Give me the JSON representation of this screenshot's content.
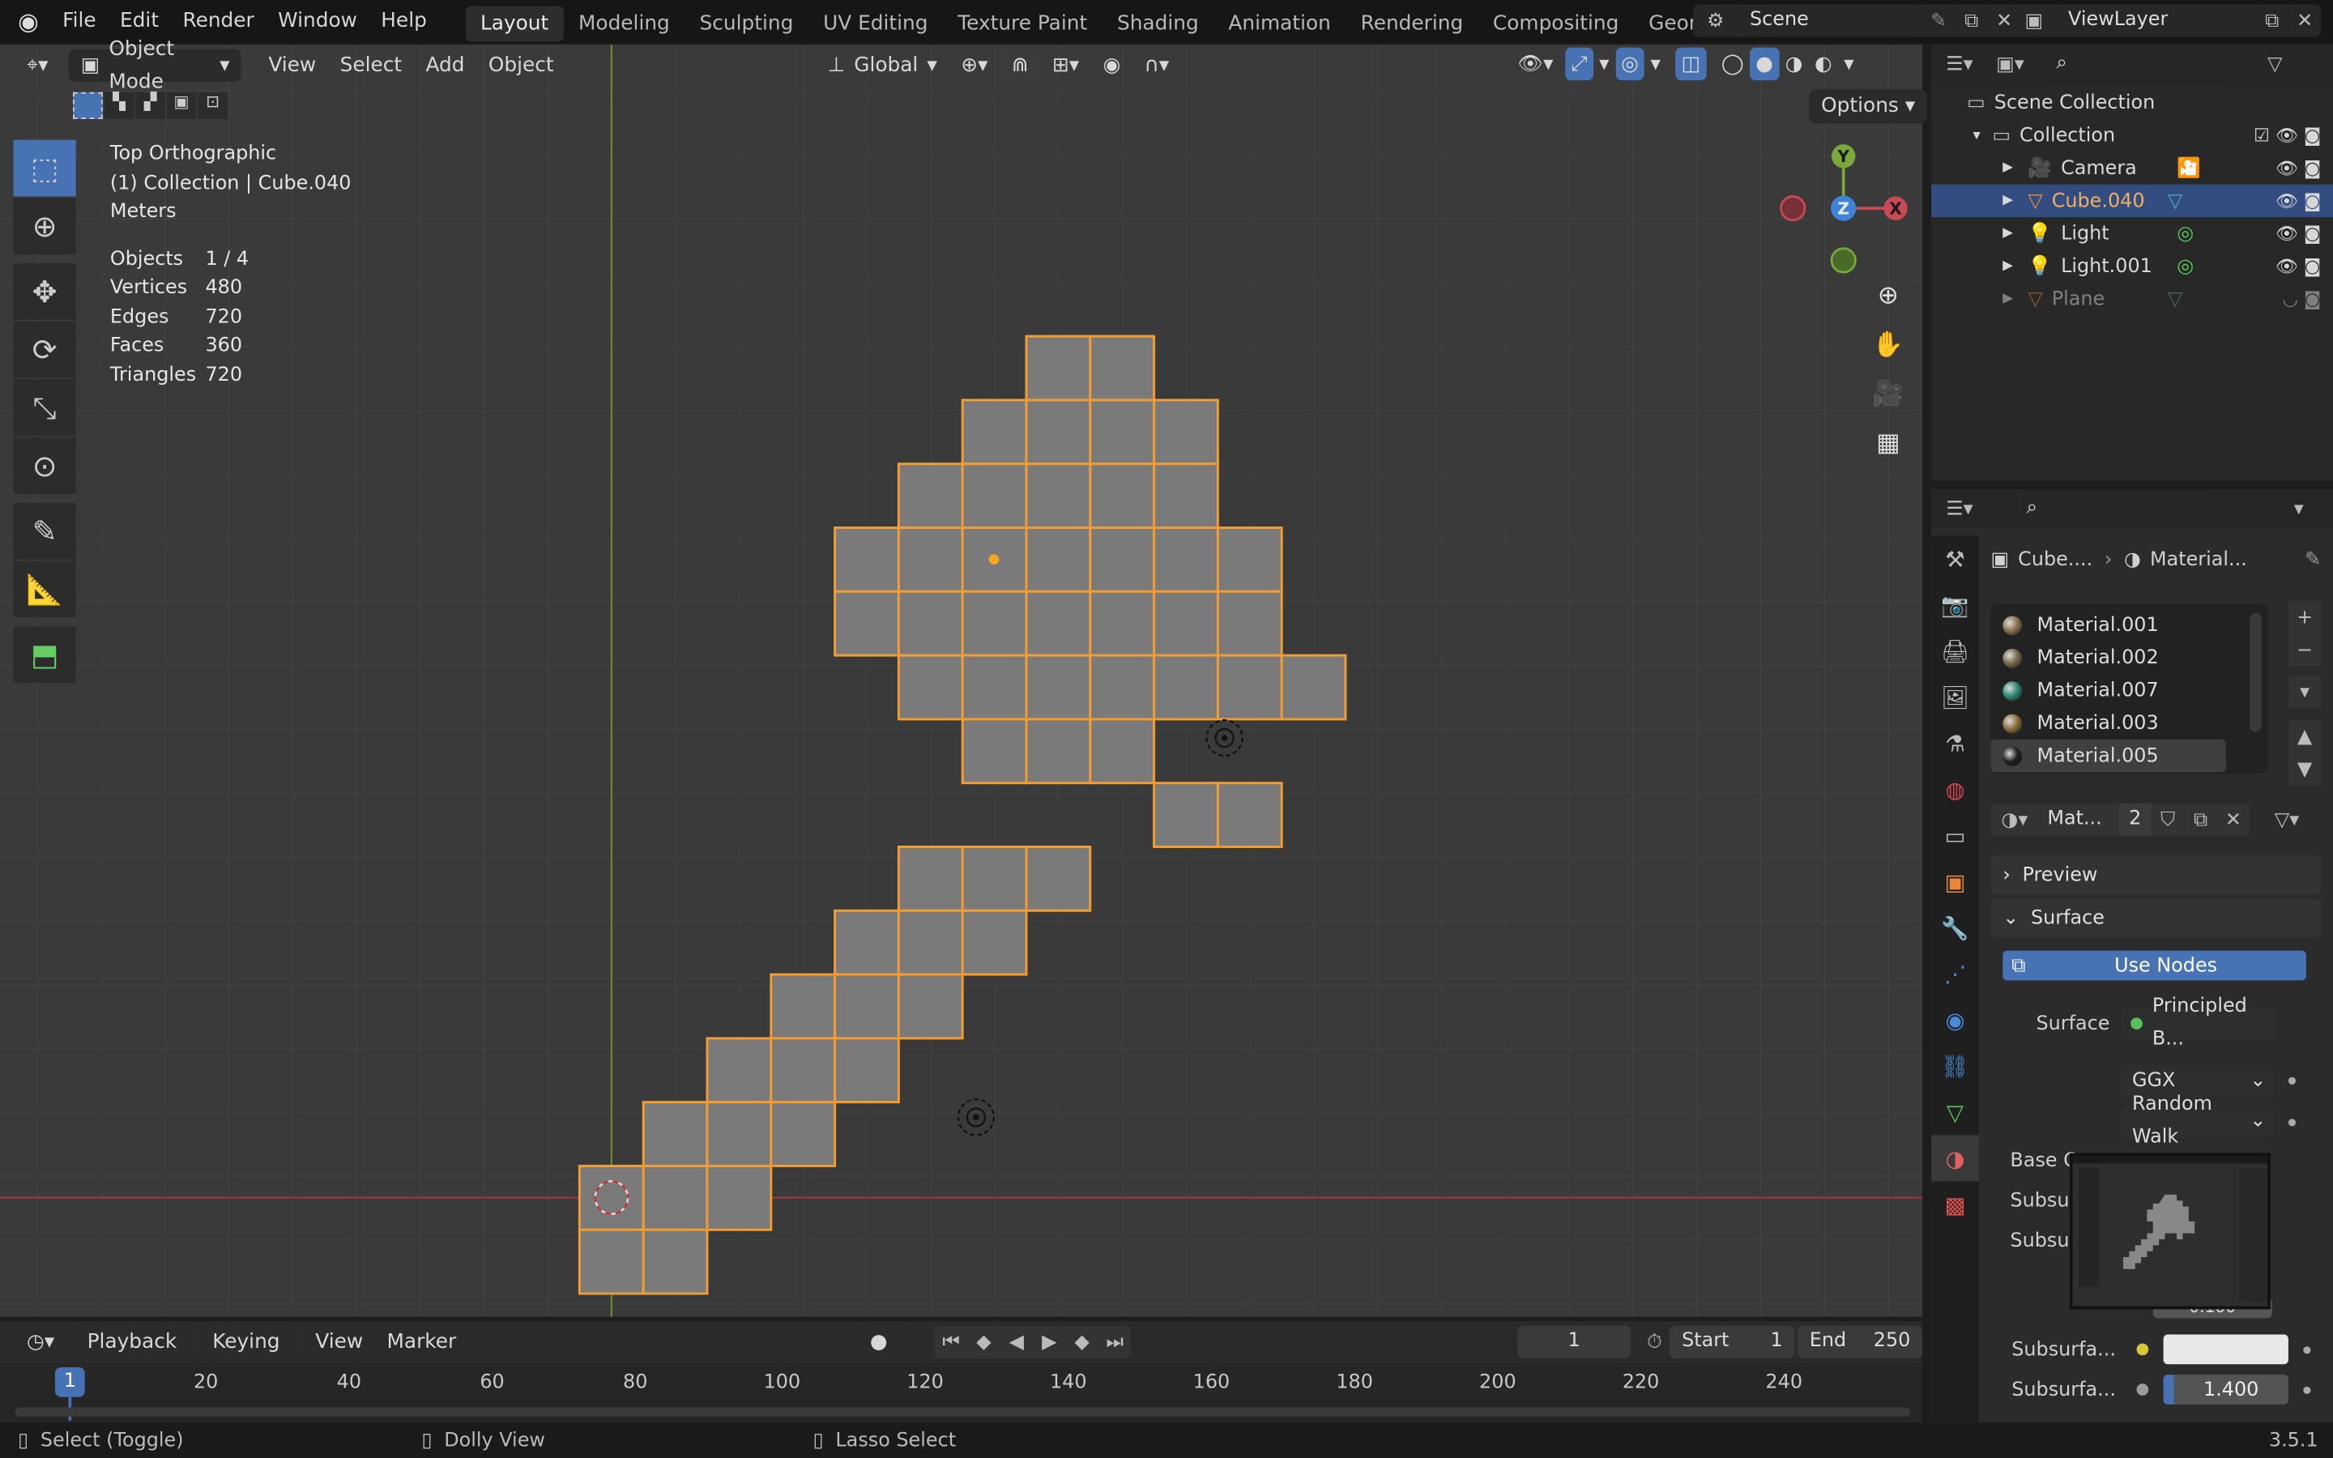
{
  "topbar": {
    "menus": [
      "File",
      "Edit",
      "Render",
      "Window",
      "Help"
    ],
    "workspaces": [
      "Layout",
      "Modeling",
      "Sculpting",
      "UV Editing",
      "Texture Paint",
      "Shading",
      "Animation",
      "Rendering",
      "Compositing",
      "Geometry Nodes"
    ],
    "active_workspace": "Layout",
    "scene": "Scene",
    "view_layer": "ViewLayer"
  },
  "viewport_header": {
    "mode": "Object Mode",
    "menus": [
      "View",
      "Select",
      "Add",
      "Object"
    ],
    "orientation": "Global",
    "options": "Options"
  },
  "overlay": {
    "view_name": "Top Orthographic",
    "collection": "(1) Collection | Cube.040",
    "units": "Meters",
    "stats": [
      {
        "label": "Objects",
        "value": "1 / 4"
      },
      {
        "label": "Vertices",
        "value": "480"
      },
      {
        "label": "Edges",
        "value": "720"
      },
      {
        "label": "Faces",
        "value": "360"
      },
      {
        "label": "Triangles",
        "value": "720"
      }
    ]
  },
  "gizmo": {
    "y": "Y",
    "z": "Z",
    "x": "X"
  },
  "outliner": {
    "scene_collection": "Scene Collection",
    "collection": "Collection",
    "items": [
      {
        "name": "Camera",
        "selected": false
      },
      {
        "name": "Cube.040",
        "selected": true
      },
      {
        "name": "Light",
        "selected": false
      },
      {
        "name": "Light.001",
        "selected": false
      },
      {
        "name": "Plane",
        "selected": false
      }
    ]
  },
  "properties": {
    "breadcrumb_object": "Cube....",
    "breadcrumb_material": "Material...",
    "materials": [
      {
        "name": "Material.001",
        "color": "#8a7350"
      },
      {
        "name": "Material.002",
        "color": "#7a6a50"
      },
      {
        "name": "Material.007",
        "color": "#2e8a78"
      },
      {
        "name": "Material.003",
        "color": "#8a7040"
      },
      {
        "name": "Material.005",
        "color": "#202020"
      }
    ],
    "active_material": "Material.005",
    "material_field": "Mat...",
    "user_count": "2",
    "preview": "Preview",
    "surface_panel": "Surface",
    "use_nodes": "Use Nodes",
    "surface_label": "Surface",
    "surface_value": "Principled B...",
    "distribution": "GGX",
    "subsurface_method": "Random Walk",
    "base_color_label": "Base C",
    "subsurface_label1": "Subsur",
    "subsurface_label2": "Subsur",
    "hidden_value": "0.100",
    "subsurface_color_label": "Subsurfa...",
    "subsurface_ior_label": "Subsurfa...",
    "subsurface_ior": "1.400"
  },
  "timeline": {
    "menus": [
      "Playback",
      "Keying",
      "View",
      "Marker"
    ],
    "current_frame": "1",
    "start_label": "Start",
    "start": "1",
    "end_label": "End",
    "end": "250",
    "ticks": [
      "20",
      "40",
      "60",
      "80",
      "100",
      "120",
      "140",
      "160",
      "180",
      "200",
      "220",
      "240"
    ],
    "frame_marker": "1"
  },
  "statusbar": {
    "left": "Select (Toggle)",
    "middle": "Dolly View",
    "right": "Lasso Select",
    "version": "3.5.1"
  }
}
